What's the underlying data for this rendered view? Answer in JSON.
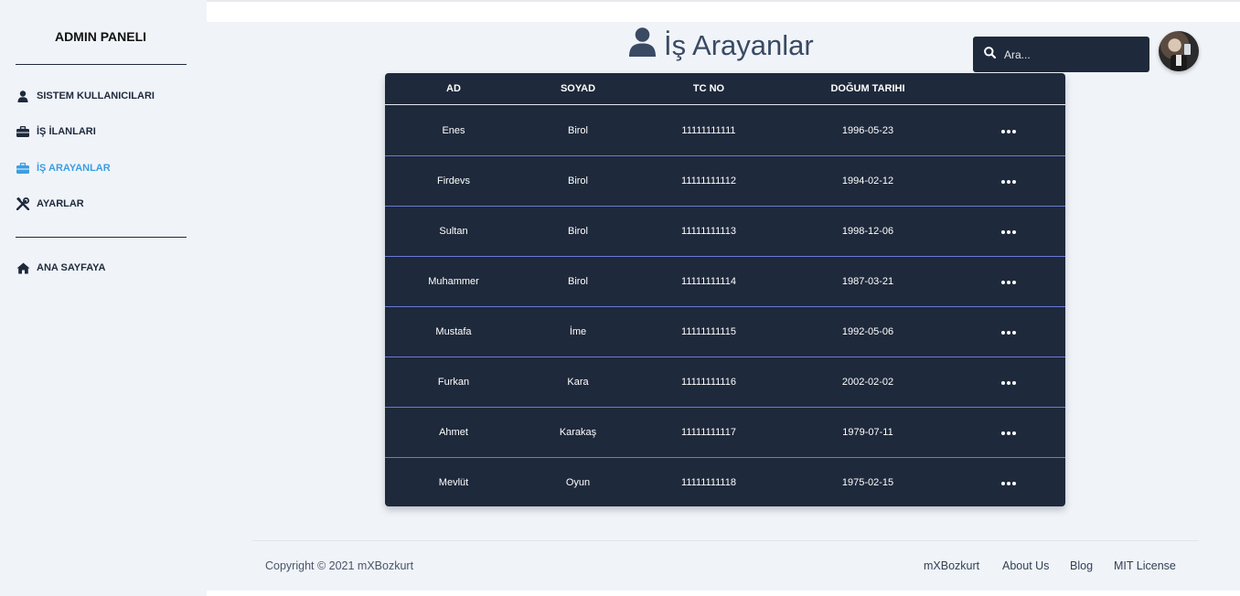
{
  "sidebar": {
    "brand": "ADMIN PANELI",
    "items": [
      {
        "label": "SISTEM KULLANICILARI",
        "icon": "user-icon",
        "active": false
      },
      {
        "label": "İŞ İLANLARI",
        "icon": "briefcase-icon",
        "active": false
      },
      {
        "label": "İŞ ARAYANLAR",
        "icon": "briefcase-icon",
        "active": true
      },
      {
        "label": "AYARLAR",
        "icon": "tools-icon",
        "active": false
      }
    ],
    "home": {
      "label": "ANA SAYFAYA",
      "icon": "home-icon"
    }
  },
  "header": {
    "title": "İş Arayanlar",
    "title_icon": "user-icon",
    "search_placeholder": "Ara...",
    "accent_color": "#3b9ee0",
    "dark_color": "#1e293b"
  },
  "table": {
    "columns": [
      "AD",
      "SOYAD",
      "TC NO",
      "DOĞUM TARIHI",
      ""
    ],
    "rows": [
      {
        "ad": "Enes",
        "soyad": "Birol",
        "tc": "11111111111",
        "dogum": "1996-05-23"
      },
      {
        "ad": "Firdevs",
        "soyad": "Birol",
        "tc": "11111111112",
        "dogum": "1994-02-12"
      },
      {
        "ad": "Sultan",
        "soyad": "Birol",
        "tc": "11111111113",
        "dogum": "1998-12-06"
      },
      {
        "ad": "Muhammer",
        "soyad": "Birol",
        "tc": "11111111114",
        "dogum": "1987-03-21"
      },
      {
        "ad": "Mustafa",
        "soyad": "İme",
        "tc": "11111111115",
        "dogum": "1992-05-06"
      },
      {
        "ad": "Furkan",
        "soyad": "Kara",
        "tc": "11111111116",
        "dogum": "2002-02-02"
      },
      {
        "ad": "Ahmet",
        "soyad": "Karakaş",
        "tc": "11111111117",
        "dogum": "1979-07-11"
      },
      {
        "ad": "Mevlüt",
        "soyad": "Oyun",
        "tc": "11111111118",
        "dogum": "1975-02-15"
      }
    ]
  },
  "footer": {
    "copyright": "Copyright © 2021 mXBozkurt",
    "links": [
      "mXBozkurt",
      "About Us",
      "Blog",
      "MIT License"
    ]
  }
}
